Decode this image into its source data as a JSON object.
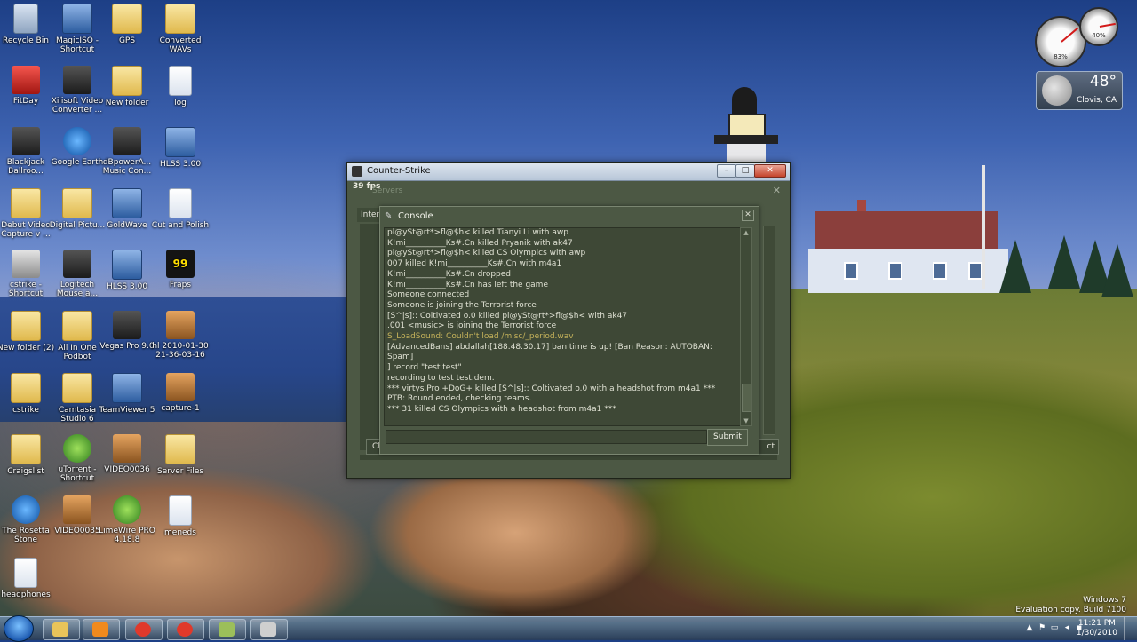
{
  "desktop_icons": [
    {
      "label": "Recycle Bin",
      "icon": "recycle-bin-icon"
    },
    {
      "label": "MagicISO - Shortcut",
      "icon": "magiciso-icon"
    },
    {
      "label": "GPS",
      "icon": "folder-icon"
    },
    {
      "label": "Converted WAVs",
      "icon": "folder-icon"
    },
    {
      "label": "FitDay",
      "icon": "fitday-icon"
    },
    {
      "label": "Xilisoft Video Converter ...",
      "icon": "film-reel-icon"
    },
    {
      "label": "New folder",
      "icon": "folder-icon"
    },
    {
      "label": "log",
      "icon": "document-icon"
    },
    {
      "label": "Blackjack Ballroo...",
      "icon": "casino-icon"
    },
    {
      "label": "Google Earth",
      "icon": "globe-icon"
    },
    {
      "label": "dBpowerA... Music Con...",
      "icon": "speaker-icon"
    },
    {
      "label": "HLSS 3.00",
      "icon": "gear-icon"
    },
    {
      "label": "Debut Video Capture v ...",
      "icon": "folder-icon"
    },
    {
      "label": "Digital Pictu...",
      "icon": "folder-icon"
    },
    {
      "label": "GoldWave",
      "icon": "goldwave-icon"
    },
    {
      "label": "Cut and Polish",
      "icon": "document-icon"
    },
    {
      "label": "cstrike - Shortcut",
      "icon": "counter-strike-icon"
    },
    {
      "label": "Logitech Mouse a...",
      "icon": "mouse-icon"
    },
    {
      "label": "HLSS 3.00",
      "icon": "gear-icon"
    },
    {
      "label": "Fraps",
      "icon": "fraps-icon"
    },
    {
      "label": "New folder (2)",
      "icon": "folder-icon"
    },
    {
      "label": "All In One Podbot",
      "icon": "folder-icon"
    },
    {
      "label": "Vegas Pro 9.0",
      "icon": "vegas-icon"
    },
    {
      "label": "hl 2010-01-30 21-36-03-16",
      "icon": "video-icon"
    },
    {
      "label": "cstrike",
      "icon": "folder-icon"
    },
    {
      "label": "Camtasia Studio 6",
      "icon": "camtasia-icon"
    },
    {
      "label": "TeamViewer 5",
      "icon": "teamviewer-icon"
    },
    {
      "label": "capture-1",
      "icon": "video-icon"
    },
    {
      "label": "Craigslist",
      "icon": "folder-icon"
    },
    {
      "label": "uTorrent - Shortcut",
      "icon": "utorrent-icon"
    },
    {
      "label": "VIDEO0036",
      "icon": "video-icon"
    },
    {
      "label": "Server Files",
      "icon": "folder-icon"
    },
    {
      "label": "The Rosetta Stone",
      "icon": "globe-icon"
    },
    {
      "label": "VIDEO0035",
      "icon": "video-icon"
    },
    {
      "label": "LimeWire PRO 4.18.8",
      "icon": "limewire-icon"
    },
    {
      "label": "meneds",
      "icon": "document-icon"
    },
    {
      "label": "headphones",
      "icon": "document-icon"
    }
  ],
  "gadgets": {
    "meter": {
      "cpu_percent": "83%",
      "memory_percent": "40%"
    },
    "weather": {
      "temperature": "48°",
      "city": "Clovis, CA"
    }
  },
  "cs_window": {
    "title": "Counter-Strike",
    "fps": "39 fps",
    "servers_title": "Servers",
    "tab_label": "Inter",
    "left_button_label": "Ch",
    "right_button_label": "ct",
    "console": {
      "title": "Console",
      "lines": [
        {
          "text": "pl@ySt@rt*>fl@$h< killed Tianyi Li with awp",
          "style": "normal"
        },
        {
          "text": "K!mi__________Ks#.Cn killed Pryanik with ak47",
          "style": "normal"
        },
        {
          "text": "pl@ySt@rt*>fl@$h< killed CS Olympics with awp",
          "style": "normal"
        },
        {
          "text": "007 killed K!mi__________Ks#.Cn with m4a1",
          "style": "normal"
        },
        {
          "text": "K!mi__________Ks#.Cn dropped",
          "style": "normal"
        },
        {
          "text": "K!mi__________Ks#.Cn has left the game",
          "style": "normal"
        },
        {
          "text": "Someone connected",
          "style": "normal"
        },
        {
          "text": "Someone is joining the Terrorist force",
          "style": "normal"
        },
        {
          "text": "[S^|s]:: Coltivated o.0 killed pl@ySt@rt*>fl@$h< with ak47",
          "style": "normal"
        },
        {
          "text": ".001 <music> is joining the Terrorist force",
          "style": "normal"
        },
        {
          "text": "S_LoadSound: Couldn't load /misc/_period.wav",
          "style": "warn"
        },
        {
          "text": "[AdvancedBans] abdallah[188.48.30.17] ban time is up! [Ban Reason: AUTOBAN: Spam]",
          "style": "wrap"
        },
        {
          "text": "] record \"test test\"",
          "style": "normal"
        },
        {
          "text": "recording to test test.dem.",
          "style": "normal"
        },
        {
          "text": "*** virtys.Pro +DoG+ killed [S^|s]:: Coltivated o.0 with a headshot from m4a1 ***",
          "style": "normal"
        },
        {
          "text": "PTB: Round ended, checking teams.",
          "style": "normal"
        },
        {
          "text": "*** 31 killed CS Olympics with a headshot from m4a1 ***",
          "style": "normal"
        }
      ],
      "input_value": "",
      "submit_label": "Submit"
    }
  },
  "watermark": {
    "line1": "Windows 7",
    "line2": "Evaluation copy. Build 7100"
  },
  "taskbar": {
    "items": [
      {
        "name": "explorer",
        "icon": "folder-icon",
        "color": "#e9c45a"
      },
      {
        "name": "media-player",
        "icon": "media-player-icon",
        "color": "#f08a1d"
      },
      {
        "name": "chrome-1",
        "icon": "chrome-icon",
        "color": "#e0392b"
      },
      {
        "name": "chrome-2",
        "icon": "chrome-icon",
        "color": "#e0392b"
      },
      {
        "name": "camtasia",
        "icon": "camtasia-icon",
        "color": "#9cbf5a"
      },
      {
        "name": "counter-strike",
        "icon": "counter-strike-icon",
        "color": "#cfcfcf"
      }
    ],
    "clock": {
      "time": "11:21 PM",
      "date": "1/30/2010"
    }
  }
}
